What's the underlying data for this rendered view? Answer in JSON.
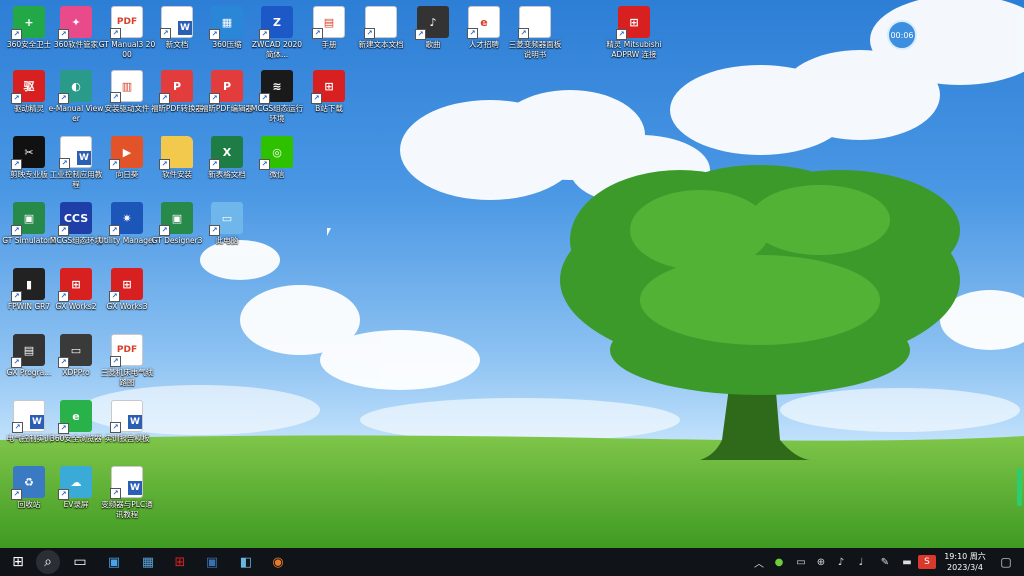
{
  "desktop": {
    "icons": [
      {
        "label": "360安全卫士",
        "color": "#23a848",
        "glyph": "+",
        "icon": "shield-plus-icon"
      },
      {
        "label": "360软件管家",
        "color": "#e94a8a",
        "glyph": "✦",
        "icon": "pinwheel-icon"
      },
      {
        "label": "GT Manual3 2000",
        "color": "#ffffff",
        "glyph": "PDF",
        "icon": "pdf-icon"
      },
      {
        "label": "新文档",
        "color": "#ffffff",
        "glyph": "W",
        "icon": "word-doc-icon"
      },
      {
        "label": "360压缩",
        "color": "#2a86d6",
        "glyph": "▦",
        "icon": "archive-icon"
      },
      {
        "label": "ZWCAD 2020 简体...",
        "color": "#1d58c7",
        "glyph": "Z",
        "icon": "zwcad-icon"
      },
      {
        "label": "手册",
        "color": "#ffffff",
        "glyph": "▤",
        "icon": "book-icon"
      },
      {
        "label": "新建文本文档",
        "color": "#ffffff",
        "glyph": "",
        "icon": "text-file-icon"
      },
      {
        "label": "歌曲",
        "color": "#333333",
        "glyph": "♪",
        "icon": "music-icon"
      },
      {
        "label": "人才招聘",
        "color": "#ffffff",
        "glyph": "e",
        "icon": "ie-shortcut-icon"
      },
      {
        "label": "三菱变频器面板说明书",
        "color": "#ffffff",
        "glyph": "",
        "icon": "document-icon"
      },
      {
        "label": "精灵 Mitsubishi ADPRW 连接",
        "color": "#d92020",
        "glyph": "⊞",
        "icon": "app-grid-icon"
      },
      {
        "label": "驱动精灵",
        "color": "#d92020",
        "glyph": "驱",
        "icon": "driver-icon"
      },
      {
        "label": "e-Manual Viewer",
        "color": "#2a9a8a",
        "glyph": "◐",
        "icon": "manual-viewer-icon"
      },
      {
        "label": "安装驱动文件",
        "color": "#ffffff",
        "glyph": "▥",
        "icon": "installer-icon"
      },
      {
        "label": "福昕PDF转换器",
        "color": "#e23c3c",
        "glyph": "P",
        "icon": "pdf-converter-icon"
      },
      {
        "label": "福昕PDF编辑器",
        "color": "#e23c3c",
        "glyph": "P",
        "icon": "pdf-editor-icon"
      },
      {
        "label": "MCGS组态运行环境",
        "color": "#1a1a1a",
        "glyph": "≋",
        "icon": "oscilloscope-icon"
      },
      {
        "label": "B站下载",
        "color": "#d92020",
        "glyph": "⊞",
        "icon": "download-grid-icon"
      },
      {
        "label": "剪映专业版",
        "color": "#111111",
        "glyph": "✂",
        "icon": "capcut-icon"
      },
      {
        "label": "工业控制应用教程",
        "color": "#ffffff",
        "glyph": "W",
        "icon": "word-doc-icon"
      },
      {
        "label": "向日葵",
        "color": "#e2532a",
        "glyph": "▶",
        "icon": "sunflower-icon"
      },
      {
        "label": "软件安装",
        "color": "#f2c94c",
        "glyph": "",
        "icon": "folder-icon"
      },
      {
        "label": "新表格文档",
        "color": "#1e7d45",
        "glyph": "X",
        "icon": "excel-icon"
      },
      {
        "label": "微信",
        "color": "#2dc100",
        "glyph": "◎",
        "icon": "wechat-icon"
      },
      {
        "label": "GT Simulator3",
        "color": "#27894a",
        "glyph": "▣",
        "icon": "gt-simulator-icon"
      },
      {
        "label": "MCGS组态环境",
        "color": "#1e3fa8",
        "glyph": "CCS",
        "icon": "mcgs-icon"
      },
      {
        "label": "Utility Manager",
        "color": "#1c56b8",
        "glyph": "✷",
        "icon": "utility-icon"
      },
      {
        "label": "GT Designer3",
        "color": "#27894a",
        "glyph": "▣",
        "icon": "gt-designer-icon"
      },
      {
        "label": "此电脑",
        "color": "#6fb6ea",
        "glyph": "▭",
        "icon": "computer-icon"
      },
      {
        "label": "FPWIN GR7",
        "color": "#222222",
        "glyph": "▮",
        "icon": "fpwin-icon"
      },
      {
        "label": "GX Works2",
        "color": "#d92020",
        "glyph": "⊞",
        "icon": "gx-works2-icon"
      },
      {
        "label": "GX Works3",
        "color": "#d92020",
        "glyph": "⊞",
        "icon": "gx-works3-icon"
      },
      {
        "label": "GX Progra...",
        "color": "#333333",
        "glyph": "▤",
        "icon": "gx-programmer-icon"
      },
      {
        "label": "XDPPro",
        "color": "#3a3a3a",
        "glyph": "▭",
        "icon": "xdppro-icon"
      },
      {
        "label": "三菱机床电气线路图",
        "color": "#ffffff",
        "glyph": "PDF",
        "icon": "pdf-icon"
      },
      {
        "label": "电气控制实训",
        "color": "#ffffff",
        "glyph": "W",
        "icon": "word-doc-icon"
      },
      {
        "label": "360安全浏览器",
        "color": "#2ab24a",
        "glyph": "e",
        "icon": "browser-icon"
      },
      {
        "label": "实训报告模板",
        "color": "#ffffff",
        "glyph": "W",
        "icon": "word-doc-icon"
      },
      {
        "label": "回收站",
        "color": "#3a7ac2",
        "glyph": "♻",
        "icon": "recycle-bin-icon"
      },
      {
        "label": "EV录屏",
        "color": "#3aaad6",
        "glyph": "☁",
        "icon": "recorder-icon"
      },
      {
        "label": "变频器与PLC通讯教程",
        "color": "#ffffff",
        "glyph": "W",
        "icon": "word-doc-icon"
      }
    ]
  },
  "overlay": {
    "timer": "00:06"
  },
  "taskbar": {
    "apps": [
      {
        "icon": "start-windows-icon"
      },
      {
        "icon": "search-icon"
      },
      {
        "icon": "task-view-icon"
      },
      {
        "icon": "file-explorer-icon"
      },
      {
        "icon": "calculator-icon"
      },
      {
        "icon": "gx-works-taskbar-icon"
      },
      {
        "icon": "gt-designer-taskbar-icon"
      },
      {
        "icon": "notepad-icon"
      },
      {
        "icon": "media-player-icon"
      }
    ],
    "tray": [
      {
        "icon": "chevron-up-icon"
      },
      {
        "icon": "360-tray-icon"
      },
      {
        "icon": "usb-icon"
      },
      {
        "icon": "network-icon"
      },
      {
        "icon": "volume-icon"
      },
      {
        "icon": "microphone-icon"
      },
      {
        "icon": "pen-icon"
      },
      {
        "icon": "keyboard-icon"
      },
      {
        "icon": "input-method-icon"
      }
    ],
    "time": "19:10 周六",
    "date": "2023/3/4"
  }
}
